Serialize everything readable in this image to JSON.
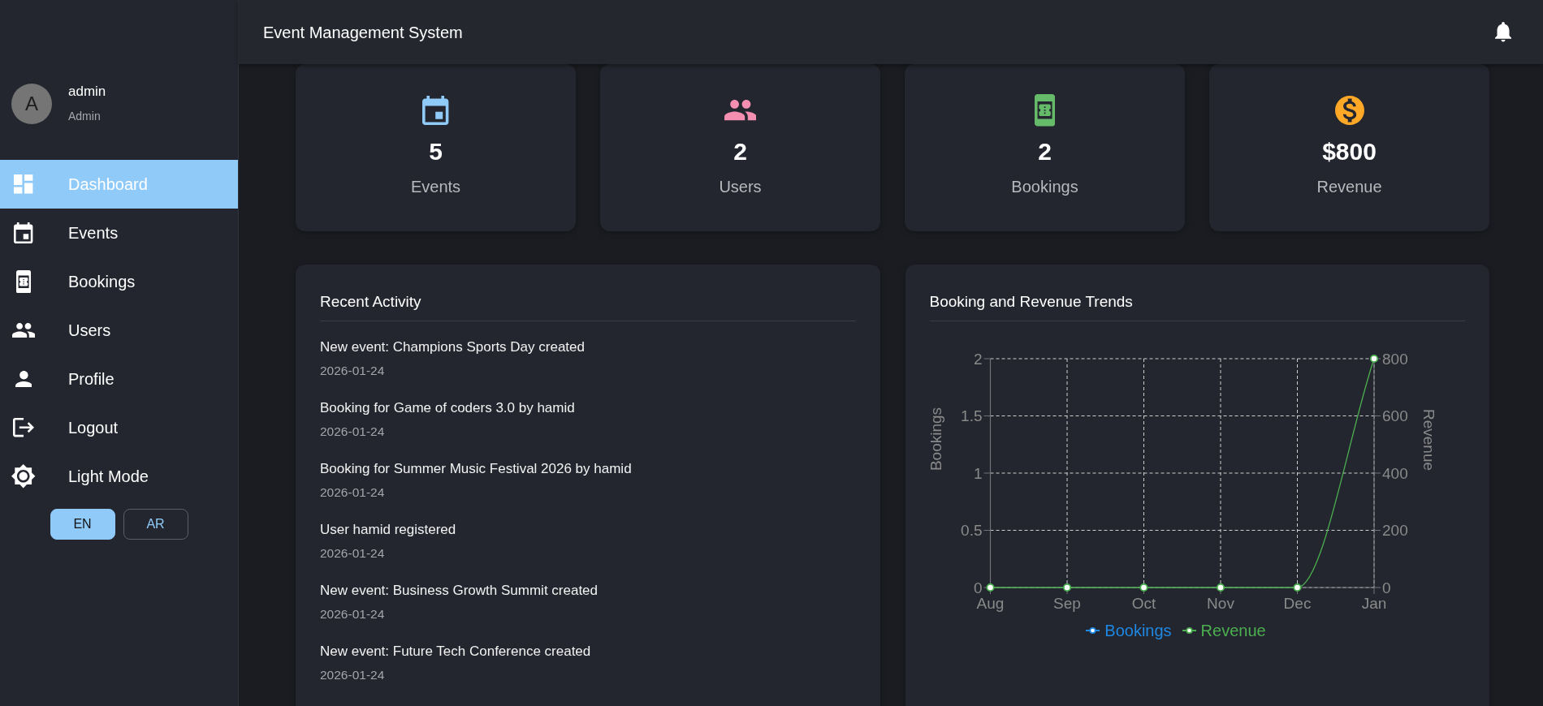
{
  "app_bar": {
    "title": "Event Management System"
  },
  "sidebar": {
    "user": {
      "initial": "A",
      "name": "admin",
      "role": "Admin"
    },
    "nav": [
      {
        "label": "Dashboard",
        "selected": true
      },
      {
        "label": "Events",
        "selected": false
      },
      {
        "label": "Bookings",
        "selected": false
      },
      {
        "label": "Users",
        "selected": false
      },
      {
        "label": "Profile",
        "selected": false
      },
      {
        "label": "Logout",
        "selected": false
      },
      {
        "label": "Light Mode",
        "selected": false
      }
    ],
    "languages": [
      {
        "label": "EN",
        "selected": true
      },
      {
        "label": "AR",
        "selected": false
      }
    ]
  },
  "stats": [
    {
      "value": "5",
      "label": "Events",
      "color": "#90caf9"
    },
    {
      "value": "2",
      "label": "Users",
      "color": "#f48fb1"
    },
    {
      "value": "2",
      "label": "Bookings",
      "color": "#66bb6a"
    },
    {
      "value": "$800",
      "label": "Revenue",
      "color": "#ffa726"
    }
  ],
  "recent_activity": {
    "title": "Recent Activity",
    "items": [
      {
        "text": "New event: Champions Sports Day created",
        "date": "2026-01-24"
      },
      {
        "text": "Booking for Game of coders 3.0 by hamid",
        "date": "2026-01-24"
      },
      {
        "text": "Booking for Summer Music Festival 2026 by hamid",
        "date": "2026-01-24"
      },
      {
        "text": "User hamid registered",
        "date": "2026-01-24"
      },
      {
        "text": "New event: Business Growth Summit created",
        "date": "2026-01-24"
      },
      {
        "text": "New event: Future Tech Conference created",
        "date": "2026-01-24"
      }
    ]
  },
  "trends": {
    "title": "Booking and Revenue Trends",
    "chart_data": {
      "type": "line",
      "categories": [
        "Aug",
        "Sep",
        "Oct",
        "Nov",
        "Dec",
        "Jan"
      ],
      "ylabel": "Bookings",
      "y2label": "Revenue",
      "ylim": [
        0,
        2
      ],
      "yticks": [
        0,
        0.5,
        1,
        1.5,
        2
      ],
      "y2lim": [
        0,
        800
      ],
      "y2ticks": [
        0,
        200,
        400,
        600,
        800
      ],
      "grid": true,
      "legend": true,
      "series": [
        {
          "name": "Bookings",
          "color": "#1e88e5",
          "marker": "circle",
          "values": [
            null,
            null,
            null,
            null,
            null,
            null
          ]
        },
        {
          "name": "Revenue",
          "color": "#4caf50",
          "axis": "y2",
          "marker": "circle",
          "values": [
            0,
            0,
            0,
            0,
            0,
            800
          ]
        }
      ]
    }
  }
}
